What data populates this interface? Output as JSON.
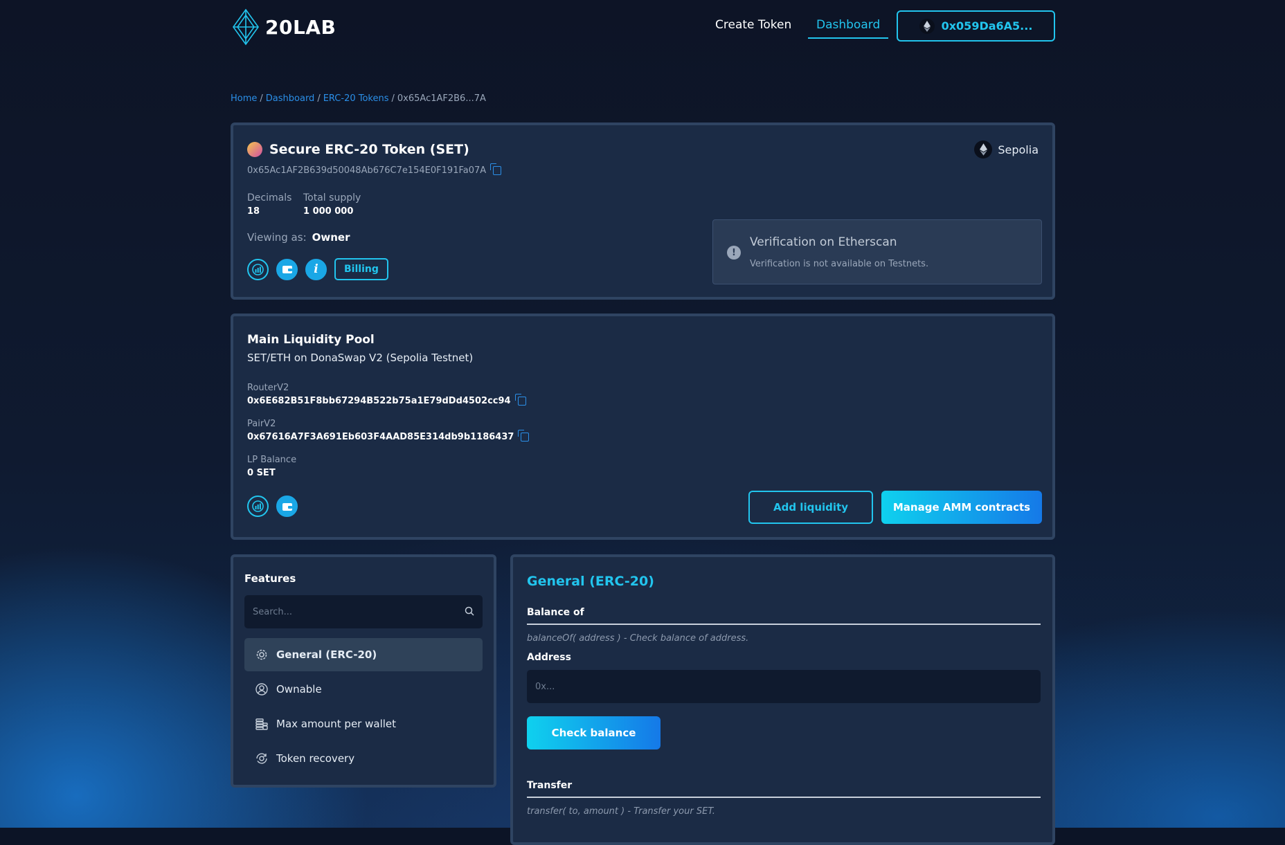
{
  "header": {
    "logo_text": "20LAB",
    "nav": {
      "create_token": "Create Token",
      "dashboard": "Dashboard"
    },
    "wallet_address": "0x059Da6A5..."
  },
  "breadcrumb": {
    "home": "Home",
    "dashboard": "Dashboard",
    "erc20": "ERC-20 Tokens",
    "current": "0x65Ac1AF2B6...7A"
  },
  "token": {
    "name": "Secure ERC-20 Token (SET)",
    "address": "0x65Ac1AF2B639d50048Ab676C7e154E0F191Fa07A",
    "network": "Sepolia",
    "decimals_label": "Decimals",
    "decimals_value": "18",
    "supply_label": "Total supply",
    "supply_value": "1 000 000",
    "viewing_label": "Viewing as:",
    "viewing_value": "Owner",
    "billing_label": "Billing",
    "verification": {
      "title": "Verification on Etherscan",
      "text": "Verification is not available on Testnets."
    }
  },
  "pool": {
    "title": "Main Liquidity Pool",
    "subtitle": "SET/ETH on DonaSwap V2 (Sepolia Testnet)",
    "router_label": "RouterV2",
    "router_value": "0x6E682B51F8bb67294B522b75a1E79dDd4502cc94",
    "pair_label": "PairV2",
    "pair_value": "0x67616A7F3A691Eb603F4AAD85E314db9b1186437",
    "lp_label": "LP Balance",
    "lp_value": "0 SET",
    "add_liquidity": "Add liquidity",
    "manage_amm": "Manage AMM contracts"
  },
  "features": {
    "title": "Features",
    "search_placeholder": "Search...",
    "items": [
      {
        "label": "General (ERC-20)",
        "icon": "gear-icon"
      },
      {
        "label": "Ownable",
        "icon": "user-icon"
      },
      {
        "label": "Max amount per wallet",
        "icon": "coins-icon"
      },
      {
        "label": "Token recovery",
        "icon": "recovery-icon"
      }
    ]
  },
  "general": {
    "title": "General (ERC-20)",
    "balance_heading": "Balance of",
    "balance_desc": "balanceOf( address ) - Check balance of address.",
    "address_label": "Address",
    "address_placeholder": "0x...",
    "check_balance": "Check balance",
    "transfer_heading": "Transfer",
    "transfer_desc": "transfer( to, amount ) - Transfer your SET."
  },
  "colors": {
    "accent": "#22c5ee",
    "link": "#2b8fe8",
    "card": "#1b2b45"
  }
}
